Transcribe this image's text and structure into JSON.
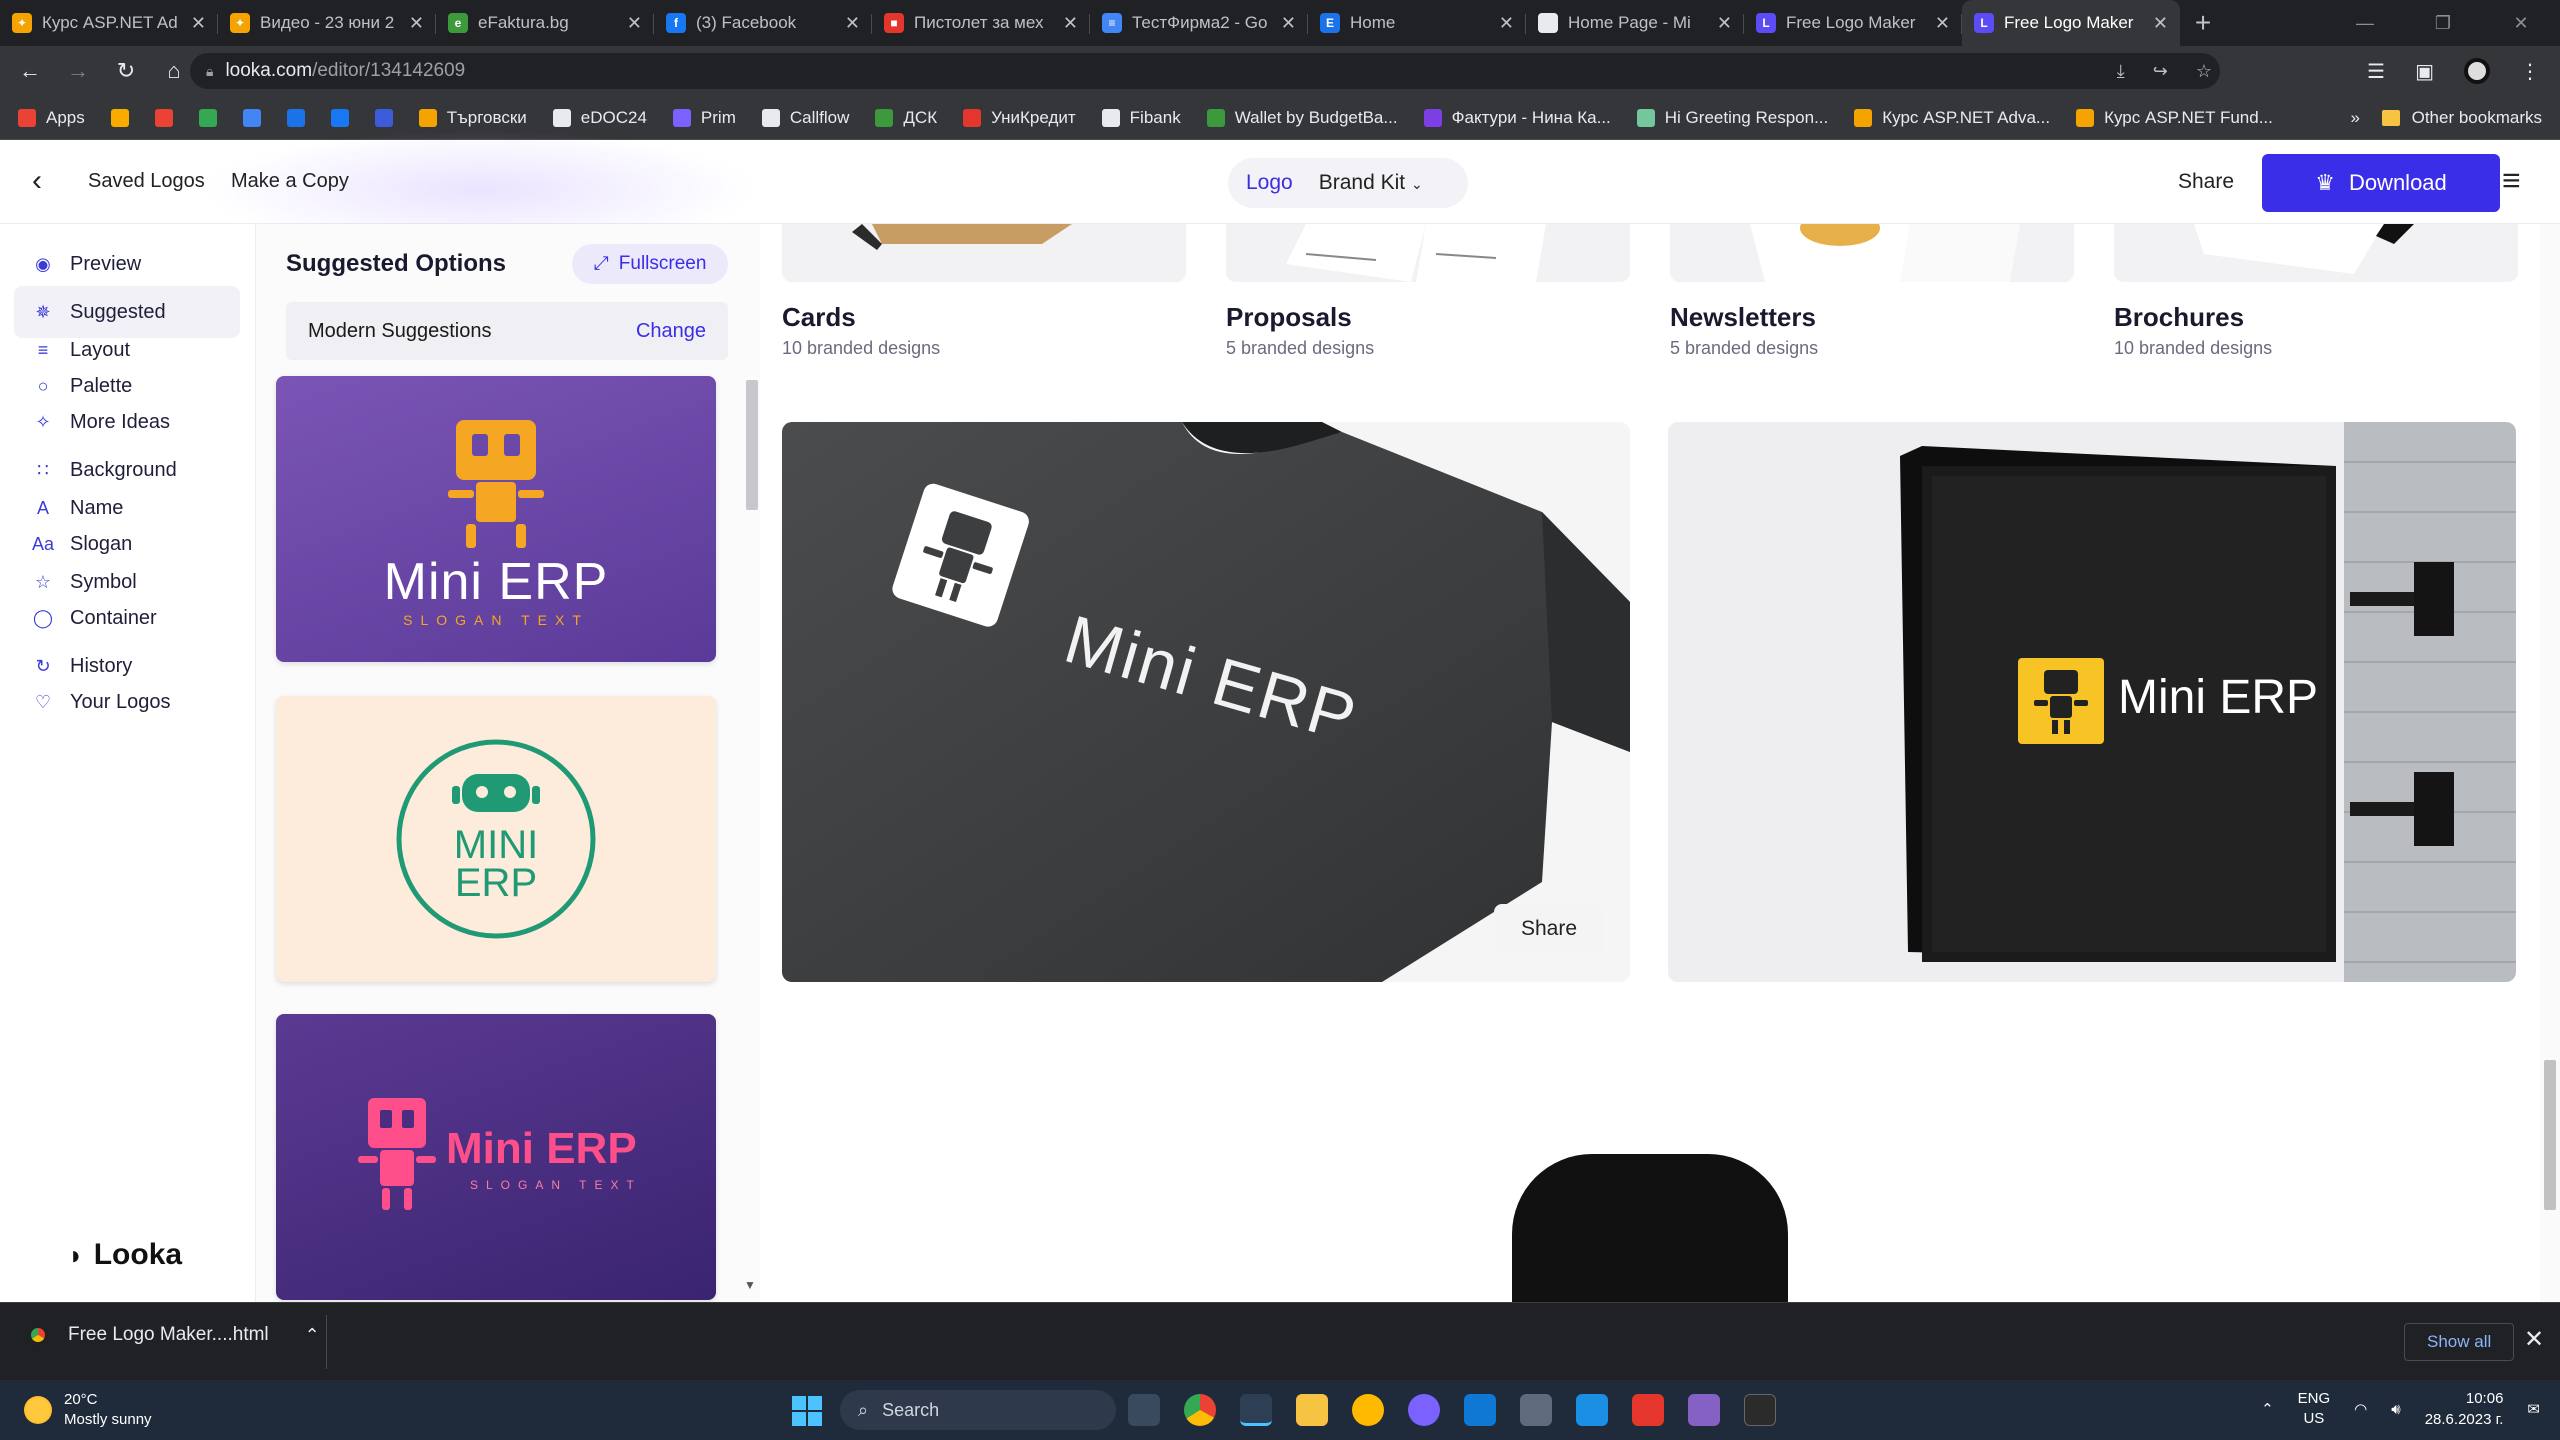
{
  "browser": {
    "tabs": [
      {
        "title": "Курс ASP.NET Ad",
        "favicon_color": "#f4a300",
        "glyph": "✦"
      },
      {
        "title": "Видео - 23 юни 2",
        "favicon_color": "#f4a300",
        "glyph": "✦"
      },
      {
        "title": "eFaktura.bg",
        "favicon_color": "#3c9a3c",
        "glyph": "e"
      },
      {
        "title": "(3) Facebook",
        "favicon_color": "#1877f2",
        "glyph": "f"
      },
      {
        "title": "Пистолет за мех",
        "favicon_color": "#e4362c",
        "glyph": "■"
      },
      {
        "title": "ТестФирма2 - Go",
        "favicon_color": "#4285f4",
        "glyph": "≡"
      },
      {
        "title": "Home",
        "favicon_color": "#1a73e8",
        "glyph": "E"
      },
      {
        "title": "Home Page - Mi",
        "favicon_color": "#e8eaed",
        "glyph": ""
      },
      {
        "title": "Free Logo Maker",
        "favicon_color": "#5b4cf5",
        "glyph": "L"
      },
      {
        "title": "Free Logo Maker",
        "favicon_color": "#5b4cf5",
        "glyph": "L",
        "active": true
      }
    ],
    "url_host": "looka.com",
    "url_path": "/editor/134142609",
    "bookmarks": [
      {
        "label": "Apps",
        "color": "#ea4335"
      },
      {
        "label": "",
        "color": "#f9ab00"
      },
      {
        "label": "",
        "color": "#ea4335"
      },
      {
        "label": "",
        "color": "#34a853"
      },
      {
        "label": "",
        "color": "#4285f4"
      },
      {
        "label": "",
        "color": "#1a73e8"
      },
      {
        "label": "",
        "color": "#1877f2"
      },
      {
        "label": "",
        "color": "#3b5bdb"
      },
      {
        "label": "Търговски",
        "color": "#f4a300"
      },
      {
        "label": "eDOC24",
        "color": "#e8eaed"
      },
      {
        "label": "Prim",
        "color": "#7b61ff"
      },
      {
        "label": "Callflow",
        "color": "#e8eaed"
      },
      {
        "label": "ДСК",
        "color": "#3c9a3c"
      },
      {
        "label": "УниКредит",
        "color": "#e4362c"
      },
      {
        "label": "Fibank",
        "color": "#e8eaed"
      },
      {
        "label": "Wallet by BudgetBa...",
        "color": "#3c9a3c"
      },
      {
        "label": "Фактури - Нина Ка...",
        "color": "#7b3fe4"
      },
      {
        "label": "Hi Greeting Respon...",
        "color": "#74c69d"
      },
      {
        "label": "Курс ASP.NET Adva...",
        "color": "#f4a300"
      },
      {
        "label": "Курс ASP.NET Fund...",
        "color": "#f4a300"
      }
    ],
    "other_bookmarks": "Other bookmarks",
    "overflow": "»"
  },
  "header": {
    "saved_logos": "Saved Logos",
    "make_copy": "Make a Copy",
    "seg_logo": "Logo",
    "seg_brand_kit": "Brand Kit",
    "share": "Share",
    "download": "Download"
  },
  "sidebar": {
    "items": [
      {
        "label": "Preview",
        "icon": "eye-icon",
        "glyph": "◉"
      },
      {
        "label": "Suggested",
        "icon": "sparkle-icon",
        "glyph": "✵",
        "active": true
      },
      {
        "label": "Layout",
        "icon": "layers-icon",
        "glyph": "≡"
      },
      {
        "label": "Palette",
        "icon": "droplet-icon",
        "glyph": "○"
      },
      {
        "label": "More Ideas",
        "icon": "wand-icon",
        "glyph": "✧"
      },
      {
        "label": "Background",
        "icon": "grid-icon",
        "glyph": "∷"
      },
      {
        "label": "Name",
        "icon": "text-box-icon",
        "glyph": "A"
      },
      {
        "label": "Slogan",
        "icon": "font-icon",
        "glyph": "Aa"
      },
      {
        "label": "Symbol",
        "icon": "star-icon",
        "glyph": "☆"
      },
      {
        "label": "Container",
        "icon": "circle-icon",
        "glyph": "◯"
      },
      {
        "label": "History",
        "icon": "history-icon",
        "glyph": "↻"
      },
      {
        "label": "Your Logos",
        "icon": "heart-icon",
        "glyph": "♡"
      }
    ],
    "brand": "Looka"
  },
  "suggested": {
    "title": "Suggested Options",
    "fullscreen": "Fullscreen",
    "mode": "Modern Suggestions",
    "change": "Change",
    "cards": [
      {
        "name": "Mini ERP",
        "slogan": "SLOGAN TEXT",
        "bg": "#6a4aa6",
        "accent": "#f5a623",
        "text": "#ffffff"
      },
      {
        "name_line1": "MINI",
        "name_line2": "ERP",
        "bg": "#fdebdc",
        "accent": "#1f9a74"
      },
      {
        "name": "Mini ERP",
        "slogan": "SLOGAN TEXT",
        "bg": "#4a2d7e",
        "accent": "#ff4f8b"
      }
    ]
  },
  "main": {
    "categories": [
      {
        "title": "Cards",
        "subtitle": "10 branded designs"
      },
      {
        "title": "Proposals",
        "subtitle": "5 branded designs"
      },
      {
        "title": "Newsletters",
        "subtitle": "5 branded designs"
      },
      {
        "title": "Brochures",
        "subtitle": "10 branded designs"
      }
    ],
    "tshirt_logo": "Mini ERP",
    "sign_logo": "Mini ERP",
    "share": "Share",
    "colors": {
      "sign_accent": "#f7c325",
      "tshirt": "#3c3e40"
    }
  },
  "downloads": {
    "file": "Free Logo Maker....html",
    "show_all": "Show all"
  },
  "taskbar": {
    "temp": "20°C",
    "weather": "Mostly sunny",
    "search": "Search",
    "lang1": "ENG",
    "lang2": "US",
    "time": "10:06",
    "date": "28.6.2023 г."
  }
}
